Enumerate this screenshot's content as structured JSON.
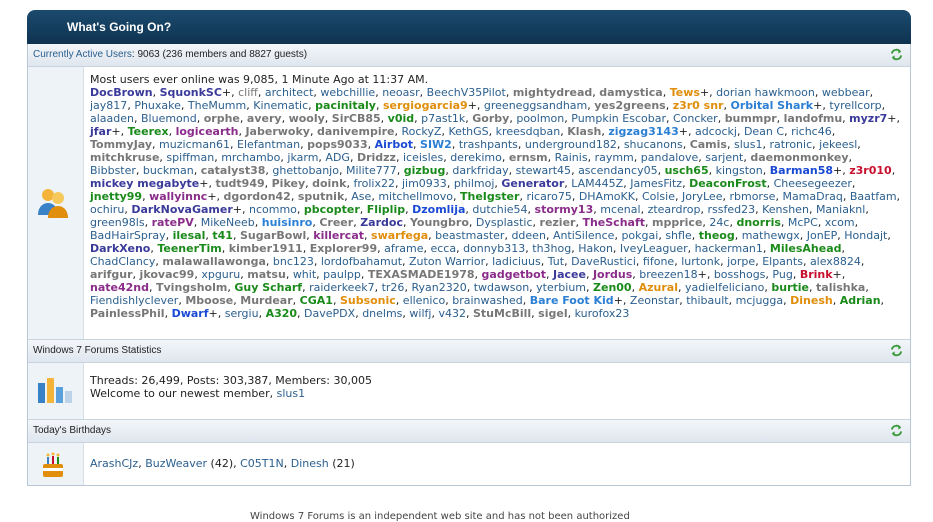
{
  "header": {
    "title": "What's Going On?"
  },
  "active_users": {
    "link": "Currently Active Users",
    "summary": ": 9063 (236 members and 8827 guests)",
    "record": "Most users ever online was 9,085, 1 Minute Ago at 11:37 AM.",
    "users": [
      {
        "n": "DocBrown",
        "c": "#3a3a9a",
        "b": true
      },
      {
        "n": "SquonkSC",
        "c": "#3a3a9a",
        "b": true,
        "p": "+"
      },
      {
        "n": "cliff",
        "c": "#777"
      },
      {
        "n": "architect",
        "c": "#2b5f8e"
      },
      {
        "n": "webchillie",
        "c": "#2b5f8e"
      },
      {
        "n": "neoasr",
        "c": "#2b5f8e"
      },
      {
        "n": "BeechV35Pilot",
        "c": "#2b5f8e"
      },
      {
        "n": "mightydread",
        "c": "#777",
        "b": true
      },
      {
        "n": "damystica",
        "c": "#777",
        "b": true
      },
      {
        "n": "Tews",
        "c": "#e08e0b",
        "b": true,
        "p": "+"
      },
      {
        "n": "dorian hawkmoon",
        "c": "#2b5f8e"
      },
      {
        "n": "webbear",
        "c": "#2b5f8e"
      },
      {
        "n": "jay817",
        "c": "#2b5f8e"
      },
      {
        "n": "Phuxake",
        "c": "#2b5f8e"
      },
      {
        "n": "TheMumm",
        "c": "#2b5f8e"
      },
      {
        "n": "Kinematic",
        "c": "#2b5f8e"
      },
      {
        "n": "pacinitaly",
        "c": "#1a8a1a",
        "b": true
      },
      {
        "n": "sergiogarcia9",
        "c": "#e08e0b",
        "b": true,
        "p": "+"
      },
      {
        "n": "greeneggsandham",
        "c": "#2b5f8e"
      },
      {
        "n": "yes2greens",
        "c": "#777",
        "b": true
      },
      {
        "n": "z3r0 snr",
        "c": "#e08e0b",
        "b": true
      },
      {
        "n": "Orbital Shark",
        "c": "#2b7fd4",
        "b": true,
        "p": "+"
      },
      {
        "n": "tyrellcorp",
        "c": "#2b5f8e"
      },
      {
        "n": "alaaden",
        "c": "#2b5f8e"
      },
      {
        "n": "Bluemond",
        "c": "#2b5f8e"
      },
      {
        "n": "orphe",
        "c": "#777",
        "b": true
      },
      {
        "n": "avery",
        "c": "#777",
        "b": true
      },
      {
        "n": "wooly",
        "c": "#777",
        "b": true
      },
      {
        "n": "SirCB85",
        "c": "#777",
        "b": true
      },
      {
        "n": "v0id",
        "c": "#1a8a1a",
        "b": true
      },
      {
        "n": "p7ast1k",
        "c": "#2b5f8e"
      },
      {
        "n": "Gorby",
        "c": "#777",
        "b": true
      },
      {
        "n": "poolmon",
        "c": "#2b5f8e"
      },
      {
        "n": "Pumpkin Escobar",
        "c": "#2b5f8e"
      },
      {
        "n": "Concker",
        "c": "#2b5f8e"
      },
      {
        "n": "bummpr",
        "c": "#777",
        "b": true
      },
      {
        "n": "landofmu",
        "c": "#777",
        "b": true
      },
      {
        "n": "myzr7",
        "c": "#3a3a9a",
        "b": true,
        "p": "+"
      },
      {
        "n": "jfar",
        "c": "#3a3a9a",
        "b": true,
        "p": "+"
      },
      {
        "n": "Teerex",
        "c": "#1a8a1a",
        "b": true
      },
      {
        "n": "logicearth",
        "c": "#8a2d8a",
        "b": true
      },
      {
        "n": "Jaberwoky",
        "c": "#777",
        "b": true
      },
      {
        "n": "danivempire",
        "c": "#777",
        "b": true
      },
      {
        "n": "RockyZ",
        "c": "#2b5f8e"
      },
      {
        "n": "KethGS",
        "c": "#2b5f8e"
      },
      {
        "n": "kreesdqban",
        "c": "#2b5f8e"
      },
      {
        "n": "Klash",
        "c": "#777",
        "b": true
      },
      {
        "n": "zigzag3143",
        "c": "#2b7fd4",
        "b": true,
        "p": "+"
      },
      {
        "n": "adcockj",
        "c": "#2b5f8e"
      },
      {
        "n": "Dean C",
        "c": "#2b5f8e"
      },
      {
        "n": "richc46",
        "c": "#2b5f8e"
      },
      {
        "n": "TommyJay",
        "c": "#777",
        "b": true
      },
      {
        "n": "muzicman61",
        "c": "#2b5f8e"
      },
      {
        "n": "Elefantman",
        "c": "#2b5f8e"
      },
      {
        "n": "pops9033",
        "c": "#777",
        "b": true
      },
      {
        "n": "Airbot",
        "c": "#1a4ad4",
        "b": true
      },
      {
        "n": "SIW2",
        "c": "#2b7fd4",
        "b": true
      },
      {
        "n": "trashpants",
        "c": "#2b5f8e"
      },
      {
        "n": "underground182",
        "c": "#2b5f8e"
      },
      {
        "n": "shucanons",
        "c": "#2b5f8e"
      },
      {
        "n": "Camis",
        "c": "#777",
        "b": true
      },
      {
        "n": "slus1",
        "c": "#2b5f8e"
      },
      {
        "n": "ratronic",
        "c": "#2b5f8e"
      },
      {
        "n": "jekeesl",
        "c": "#2b5f8e"
      },
      {
        "n": "mitchkruse",
        "c": "#777",
        "b": true
      },
      {
        "n": "spiffman",
        "c": "#2b5f8e"
      },
      {
        "n": "mrchambo",
        "c": "#2b5f8e"
      },
      {
        "n": "jkarm",
        "c": "#2b5f8e"
      },
      {
        "n": "ADG",
        "c": "#2b5f8e"
      },
      {
        "n": "Dridzz",
        "c": "#777",
        "b": true
      },
      {
        "n": "iceisles",
        "c": "#2b5f8e"
      },
      {
        "n": "derekimo",
        "c": "#2b5f8e"
      },
      {
        "n": "ernsm",
        "c": "#777",
        "b": true
      },
      {
        "n": "Rainis",
        "c": "#2b5f8e"
      },
      {
        "n": "raymm",
        "c": "#2b5f8e"
      },
      {
        "n": "pandalove",
        "c": "#2b5f8e"
      },
      {
        "n": "sarjent",
        "c": "#2b5f8e"
      },
      {
        "n": "daemonmonkey",
        "c": "#777",
        "b": true
      },
      {
        "n": "Bibbster",
        "c": "#2b5f8e"
      },
      {
        "n": "buckman",
        "c": "#2b5f8e"
      },
      {
        "n": "catalyst38",
        "c": "#777",
        "b": true
      },
      {
        "n": "ghettobanjo",
        "c": "#2b5f8e"
      },
      {
        "n": "Milite777",
        "c": "#2b5f8e"
      },
      {
        "n": "gizbug",
        "c": "#1a8a1a",
        "b": true
      },
      {
        "n": "darkfriday",
        "c": "#2b5f8e"
      },
      {
        "n": "stewart45",
        "c": "#2b5f8e"
      },
      {
        "n": "ascendancy05",
        "c": "#2b5f8e"
      },
      {
        "n": "usch65",
        "c": "#1a8a1a",
        "b": true
      },
      {
        "n": "kingston",
        "c": "#2b5f8e"
      },
      {
        "n": "Barman58",
        "c": "#1a4ad4",
        "b": true,
        "p": "+"
      },
      {
        "n": "z3r010",
        "c": "#c8102e",
        "b": true
      },
      {
        "n": "mickey megabyte",
        "c": "#3a3a9a",
        "b": true,
        "p": "+"
      },
      {
        "n": "tudt949",
        "c": "#777",
        "b": true
      },
      {
        "n": "Pikey",
        "c": "#777",
        "b": true
      },
      {
        "n": "doink",
        "c": "#777",
        "b": true
      },
      {
        "n": "frolix22",
        "c": "#2b5f8e"
      },
      {
        "n": "jim0933",
        "c": "#2b5f8e"
      },
      {
        "n": "philmoj",
        "c": "#2b5f8e"
      },
      {
        "n": "Generator",
        "c": "#3a3a9a",
        "b": true
      },
      {
        "n": "LAM445Z",
        "c": "#2b5f8e"
      },
      {
        "n": "JamesFitz",
        "c": "#2b5f8e"
      },
      {
        "n": "DeaconFrost",
        "c": "#1a8a1a",
        "b": true
      },
      {
        "n": "Cheesegeezer",
        "c": "#2b5f8e"
      },
      {
        "n": "jnetty99",
        "c": "#1a8a1a",
        "b": true
      },
      {
        "n": "wallyinnc",
        "c": "#8a2d8a",
        "b": true,
        "p": "+"
      },
      {
        "n": "dgordon42",
        "c": "#777",
        "b": true
      },
      {
        "n": "sputnik",
        "c": "#777",
        "b": true
      },
      {
        "n": "Ase",
        "c": "#2b5f8e"
      },
      {
        "n": "mitchellmovo",
        "c": "#2b5f8e"
      },
      {
        "n": "TheIgster",
        "c": "#1a8a1a",
        "b": true
      },
      {
        "n": "ricaro75",
        "c": "#2b5f8e"
      },
      {
        "n": "DHAmoKK",
        "c": "#2b5f8e"
      },
      {
        "n": "Colsie",
        "c": "#2b5f8e"
      },
      {
        "n": "JoryLee",
        "c": "#2b5f8e"
      },
      {
        "n": "rbmorse",
        "c": "#2b5f8e"
      },
      {
        "n": "MamaDraq",
        "c": "#2b5f8e"
      },
      {
        "n": "Baatfam",
        "c": "#2b5f8e"
      },
      {
        "n": "ochiru",
        "c": "#2b5f8e"
      },
      {
        "n": "DarkNovaGamer",
        "c": "#3a3a9a",
        "b": true,
        "p": "+"
      },
      {
        "n": "ncommo",
        "c": "#2b5f8e"
      },
      {
        "n": "pbcopter",
        "c": "#1a8a1a",
        "b": true
      },
      {
        "n": "Fliplip",
        "c": "#1a8a1a",
        "b": true
      },
      {
        "n": "Dzomlija",
        "c": "#1a4ad4",
        "b": true
      },
      {
        "n": "dutchie54",
        "c": "#2b5f8e"
      },
      {
        "n": "stormy13",
        "c": "#8a2d8a",
        "b": true
      },
      {
        "n": "mcenal",
        "c": "#2b5f8e"
      },
      {
        "n": "zteardrop",
        "c": "#2b5f8e"
      },
      {
        "n": "rssfed23",
        "c": "#2b5f8e"
      },
      {
        "n": "Kenshen",
        "c": "#2b5f8e"
      },
      {
        "n": "Maniaknl",
        "c": "#2b5f8e"
      },
      {
        "n": "green98ls",
        "c": "#2b5f8e"
      },
      {
        "n": "ratePV",
        "c": "#8a2d8a",
        "b": true
      },
      {
        "n": "MikeNeeb",
        "c": "#2b5f8e"
      },
      {
        "n": "huisinro",
        "c": "#2b7fd4",
        "b": true
      },
      {
        "n": "Creer",
        "c": "#777",
        "b": true
      },
      {
        "n": "Zardoc",
        "c": "#3a3a9a",
        "b": true
      },
      {
        "n": "Youngbro",
        "c": "#777",
        "b": true
      },
      {
        "n": "Dysplastic",
        "c": "#2b5f8e"
      },
      {
        "n": "rezier",
        "c": "#777",
        "b": true
      },
      {
        "n": "TheSchaft",
        "c": "#8a2d8a",
        "b": true
      },
      {
        "n": "mpprice",
        "c": "#777",
        "b": true
      },
      {
        "n": "24c",
        "c": "#2b5f8e"
      },
      {
        "n": "dnorris",
        "c": "#1a8a1a",
        "b": true
      },
      {
        "n": "McPC",
        "c": "#2b5f8e"
      },
      {
        "n": "xcom",
        "c": "#2b5f8e"
      },
      {
        "n": "BadHairSpray",
        "c": "#2b5f8e"
      },
      {
        "n": "ilesal",
        "c": "#1a8a1a",
        "b": true
      },
      {
        "n": "t41",
        "c": "#1a8a1a",
        "b": true
      },
      {
        "n": "SugarBowl",
        "c": "#777",
        "b": true
      },
      {
        "n": "killercat",
        "c": "#8a2d8a",
        "b": true
      },
      {
        "n": "swarfega",
        "c": "#e08e0b",
        "b": true
      },
      {
        "n": "beastmaster",
        "c": "#2b5f8e"
      },
      {
        "n": "ddeen",
        "c": "#2b5f8e"
      },
      {
        "n": "AntiSilence",
        "c": "#2b5f8e"
      },
      {
        "n": "pokgai",
        "c": "#2b5f8e"
      },
      {
        "n": "shfle",
        "c": "#2b5f8e"
      },
      {
        "n": "theog",
        "c": "#1a8a1a",
        "b": true
      },
      {
        "n": "mathewgx",
        "c": "#2b5f8e"
      },
      {
        "n": "JonEP",
        "c": "#2b5f8e"
      },
      {
        "n": "Hondajt",
        "c": "#2b5f8e"
      },
      {
        "n": "DarkXeno",
        "c": "#3a3a9a",
        "b": true
      },
      {
        "n": "TeenerTim",
        "c": "#1a8a1a",
        "b": true
      },
      {
        "n": "kimber1911",
        "c": "#777",
        "b": true
      },
      {
        "n": "Explorer99",
        "c": "#777",
        "b": true
      },
      {
        "n": "aframe",
        "c": "#2b5f8e"
      },
      {
        "n": "ecca",
        "c": "#2b5f8e"
      },
      {
        "n": "donnyb313",
        "c": "#2b5f8e"
      },
      {
        "n": "th3hog",
        "c": "#2b5f8e"
      },
      {
        "n": "Hakon",
        "c": "#2b5f8e"
      },
      {
        "n": "IveyLeaguer",
        "c": "#2b5f8e"
      },
      {
        "n": "hackerman1",
        "c": "#2b5f8e"
      },
      {
        "n": "MilesAhead",
        "c": "#1a8a1a",
        "b": true
      },
      {
        "n": "ChadClancy",
        "c": "#2b5f8e"
      },
      {
        "n": "malawallawonga",
        "c": "#777",
        "b": true
      },
      {
        "n": "bnc123",
        "c": "#2b5f8e"
      },
      {
        "n": "lordofbahamut",
        "c": "#2b5f8e"
      },
      {
        "n": "Zuton Warrior",
        "c": "#2b5f8e"
      },
      {
        "n": "ladiciuus",
        "c": "#2b5f8e"
      },
      {
        "n": "Tut",
        "c": "#2b5f8e"
      },
      {
        "n": "DaveRustici",
        "c": "#2b5f8e"
      },
      {
        "n": "fifone",
        "c": "#2b5f8e"
      },
      {
        "n": "lurtonk",
        "c": "#2b5f8e"
      },
      {
        "n": "jorpe",
        "c": "#2b5f8e"
      },
      {
        "n": "Elpants",
        "c": "#2b5f8e"
      },
      {
        "n": "alex8824",
        "c": "#2b5f8e"
      },
      {
        "n": "arifgur",
        "c": "#777",
        "b": true
      },
      {
        "n": "jkovac99",
        "c": "#777",
        "b": true
      },
      {
        "n": "xpguru",
        "c": "#2b5f8e"
      },
      {
        "n": "matsu",
        "c": "#777",
        "b": true
      },
      {
        "n": "whit",
        "c": "#2b5f8e"
      },
      {
        "n": "paulpp",
        "c": "#2b5f8e"
      },
      {
        "n": "TEXASMADE1978",
        "c": "#777",
        "b": true
      },
      {
        "n": "gadgetbot",
        "c": "#8a2d8a",
        "b": true
      },
      {
        "n": "Jacee",
        "c": "#3a3a9a",
        "b": true
      },
      {
        "n": "Jordus",
        "c": "#8a2d8a",
        "b": true
      },
      {
        "n": "breezen18",
        "c": "#2b5f8e",
        "p": "+"
      },
      {
        "n": "bosshogs",
        "c": "#2b5f8e"
      },
      {
        "n": "Pug",
        "c": "#2b5f8e"
      },
      {
        "n": "Brink",
        "c": "#c8102e",
        "b": true,
        "p": "+"
      },
      {
        "n": "nate42nd",
        "c": "#8a2d8a",
        "b": true
      },
      {
        "n": "Tvingsholm",
        "c": "#777",
        "b": true
      },
      {
        "n": "Guy Scharf",
        "c": "#1a8a1a",
        "b": true
      },
      {
        "n": "raiderkeek7",
        "c": "#2b5f8e"
      },
      {
        "n": "tr26",
        "c": "#2b5f8e"
      },
      {
        "n": "Ryan2320",
        "c": "#2b5f8e"
      },
      {
        "n": "twdawson",
        "c": "#2b5f8e"
      },
      {
        "n": "yterbium",
        "c": "#2b5f8e"
      },
      {
        "n": "Zen00",
        "c": "#1a8a1a",
        "b": true
      },
      {
        "n": "Azural",
        "c": "#e08e0b",
        "b": true
      },
      {
        "n": "yadielfeliciano",
        "c": "#2b5f8e"
      },
      {
        "n": "burtie",
        "c": "#1a8a1a",
        "b": true
      },
      {
        "n": "talishka",
        "c": "#777",
        "b": true
      },
      {
        "n": "Fiendishlyclever",
        "c": "#2b5f8e"
      },
      {
        "n": "Mboose",
        "c": "#777",
        "b": true
      },
      {
        "n": "Murdear",
        "c": "#777",
        "b": true
      },
      {
        "n": "CGA1",
        "c": "#1a8a1a",
        "b": true
      },
      {
        "n": "Subsonic",
        "c": "#e08e0b",
        "b": true
      },
      {
        "n": "ellenico",
        "c": "#2b5f8e"
      },
      {
        "n": "brainwashed",
        "c": "#2b5f8e"
      },
      {
        "n": "Bare Foot Kid",
        "c": "#2b7fd4",
        "b": true,
        "p": "+"
      },
      {
        "n": "Zeonstar",
        "c": "#2b5f8e"
      },
      {
        "n": "thibault",
        "c": "#2b5f8e"
      },
      {
        "n": "mcjugga",
        "c": "#2b5f8e"
      },
      {
        "n": "Dinesh",
        "c": "#e08e0b",
        "b": true
      },
      {
        "n": "Adrian",
        "c": "#1a8a1a",
        "b": true
      },
      {
        "n": "PainlessPhil",
        "c": "#777",
        "b": true
      },
      {
        "n": "Dwarf",
        "c": "#1a4ad4",
        "b": true,
        "p": "+"
      },
      {
        "n": "sergiu",
        "c": "#2b5f8e"
      },
      {
        "n": "A320",
        "c": "#1a8a1a",
        "b": true
      },
      {
        "n": "DavePDX",
        "c": "#2b5f8e"
      },
      {
        "n": "dnelms",
        "c": "#2b5f8e"
      },
      {
        "n": "wilfj",
        "c": "#2b5f8e"
      },
      {
        "n": "v432",
        "c": "#2b5f8e"
      },
      {
        "n": "StuMcBill",
        "c": "#777",
        "b": true
      },
      {
        "n": "sigel",
        "c": "#777",
        "b": true
      },
      {
        "n": "kurofox23",
        "c": "#2b5f8e"
      }
    ]
  },
  "stats": {
    "bar_label": "Windows 7 Forums Statistics",
    "line1": "Threads: 26,499, Posts: 303,387, Members: 30,005",
    "welcome": "Welcome to our newest member, ",
    "newest": "slus1"
  },
  "birthdays": {
    "bar_label": "Today's Birthdays",
    "list": [
      {
        "n": "ArashCJz",
        "age": ""
      },
      {
        "n": "BuzWeaver",
        "age": "(42)"
      },
      {
        "n": "C05T1N",
        "age": ""
      },
      {
        "n": "Dinesh",
        "age": "(21)"
      }
    ]
  },
  "footer": {
    "text": "Windows 7 Forums is an independent web site and has not been authorized"
  }
}
